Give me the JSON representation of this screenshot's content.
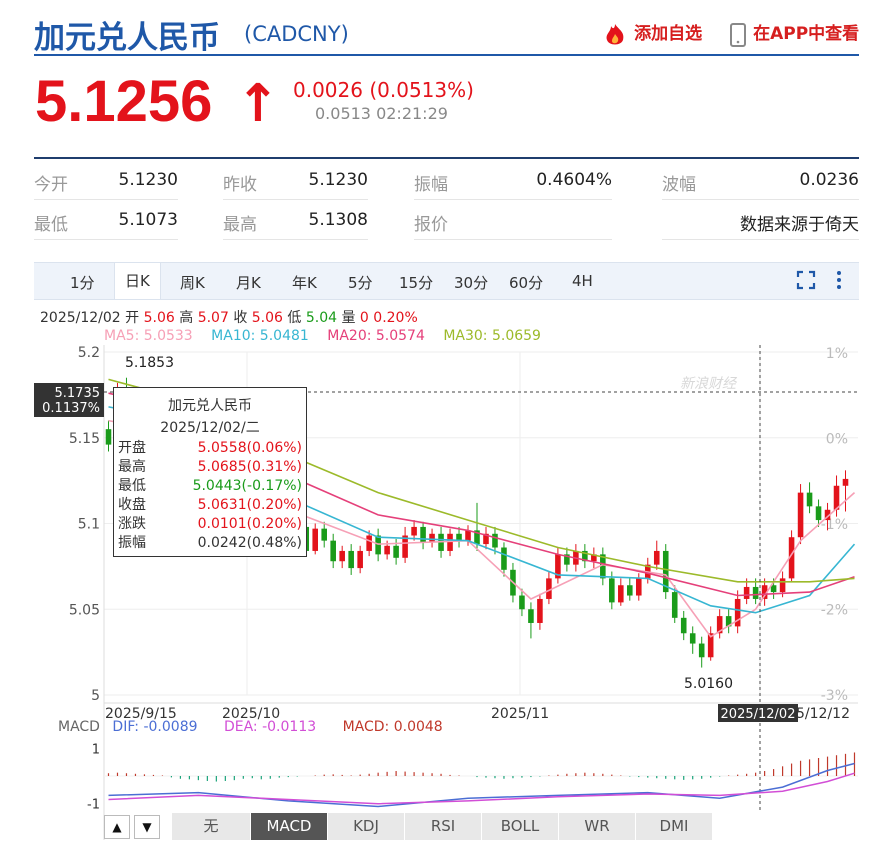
{
  "header": {
    "title": "加元兑人民币",
    "code": "(CADCNY)",
    "add_watch_label": "添加自选",
    "app_view_label": "在APP中查看"
  },
  "quote": {
    "price": "5.1256",
    "arrow": "↑",
    "change": "0.0026 (0.0513%)",
    "sub": "0.0513 02:21:29"
  },
  "stats": [
    {
      "label": "今开",
      "value": "5.1230"
    },
    {
      "label": "昨收",
      "value": "5.1230"
    },
    {
      "label": "振幅",
      "value": "0.4604%"
    },
    {
      "label": "波幅",
      "value": "0.0236"
    },
    {
      "label": "最低",
      "value": "5.1073"
    },
    {
      "label": "最高",
      "value": "5.1308"
    },
    {
      "label": "报价",
      "value": ""
    },
    {
      "label": "",
      "value": "数据来源于倚天"
    }
  ],
  "tabs": [
    "1分",
    "日K",
    "周K",
    "月K",
    "年K",
    "5分",
    "15分",
    "30分",
    "60分",
    "4H"
  ],
  "active_tab": "日K",
  "info": {
    "date": "2025/12/02",
    "open_label": "开",
    "open": "5.06",
    "high_label": "高",
    "high": "5.07",
    "close_label": "收",
    "close": "5.06",
    "low_label": "低",
    "low": "5.04",
    "vol_label": "量",
    "vol": "0",
    "pct": "0.20%"
  },
  "ma": [
    {
      "label": "MA5: 5.0533",
      "color": "#f6a0b6"
    },
    {
      "label": "MA10: 5.0481",
      "color": "#37b6d2"
    },
    {
      "label": "MA20: 5.0574",
      "color": "#e5407a"
    },
    {
      "label": "MA30: 5.0659",
      "color": "#9cba2a"
    }
  ],
  "tooltip": {
    "title": "加元兑人民币",
    "date": "2025/12/02/二",
    "rows": [
      {
        "label": "开盘",
        "value": "5.0558(0.06%)",
        "color": "#e3131b"
      },
      {
        "label": "最高",
        "value": "5.0685(0.31%)",
        "color": "#e3131b"
      },
      {
        "label": "最低",
        "value": "5.0443(-0.17%)",
        "color": "#1a9b1a"
      },
      {
        "label": "收盘",
        "value": "5.0631(0.20%)",
        "color": "#e3131b"
      },
      {
        "label": "涨跌",
        "value": "0.0101(0.20%)",
        "color": "#e3131b"
      },
      {
        "label": "振幅",
        "value": "0.0242(0.48%)",
        "color": "#333333"
      }
    ]
  },
  "crosshair": {
    "price": "5.1735",
    "pct": "0.1137%",
    "date": "2025/12/02"
  },
  "watermark": "新浪财经",
  "macd_line": {
    "label": "MACD",
    "dif": "DIF: -0.0089",
    "dea": "DEA: -0.0113",
    "macd": "MACD: 0.0048",
    "dif_color": "#4b6ed4",
    "dea_color": "#d24ed6",
    "macd_color": "#c0392b"
  },
  "indicator_buttons": [
    "无",
    "MACD",
    "KDJ",
    "RSI",
    "BOLL",
    "WR",
    "DMI"
  ],
  "active_indicator": "MACD",
  "nav_up": "▲",
  "nav_down": "▼",
  "chart_data": {
    "type": "candlestick",
    "ylim": [
      5.0,
      5.2
    ],
    "y_ticks": [
      "5.2",
      "5.15",
      "5.1",
      "5.05",
      "5"
    ],
    "pct_ticks": [
      "1%",
      "0%",
      "-1%",
      "-2%",
      "-3%"
    ],
    "x_labels": [
      "2025/9/15",
      "2025/10",
      "2025/11",
      "5/12/12"
    ],
    "annotations": {
      "high": "5.1853",
      "low": "5.0160"
    },
    "candles": [
      [
        5.155,
        5.146,
        5.16,
        5.142
      ],
      [
        5.145,
        5.178,
        5.182,
        5.143
      ],
      [
        5.178,
        5.172,
        5.185,
        5.169
      ],
      [
        5.172,
        5.16,
        5.176,
        5.156
      ],
      [
        5.16,
        5.15,
        5.164,
        5.146
      ],
      [
        5.15,
        5.163,
        5.166,
        5.147
      ],
      [
        5.163,
        5.172,
        5.176,
        5.16
      ],
      [
        5.172,
        5.16,
        5.175,
        5.156
      ],
      [
        5.16,
        5.152,
        5.164,
        5.149
      ],
      [
        5.152,
        5.156,
        5.159,
        5.148
      ],
      [
        5.156,
        5.146,
        5.16,
        5.142
      ],
      [
        5.146,
        5.135,
        5.15,
        5.132
      ],
      [
        5.135,
        5.143,
        5.146,
        5.132
      ],
      [
        5.143,
        5.14,
        5.146,
        5.136
      ],
      [
        5.14,
        5.13,
        5.144,
        5.127
      ],
      [
        5.13,
        5.128,
        5.134,
        5.124
      ],
      [
        5.128,
        5.12,
        5.132,
        5.116
      ],
      [
        5.12,
        5.117,
        5.124,
        5.113
      ],
      [
        5.117,
        5.114,
        5.12,
        5.11
      ],
      [
        5.114,
        5.104,
        5.118,
        5.101
      ],
      [
        5.104,
        5.09,
        5.108,
        5.086
      ],
      [
        5.09,
        5.098,
        5.101,
        5.084
      ],
      [
        5.098,
        5.084,
        5.101,
        5.081
      ],
      [
        5.084,
        5.097,
        5.1,
        5.082
      ],
      [
        5.097,
        5.09,
        5.101,
        5.086
      ],
      [
        5.09,
        5.078,
        5.094,
        5.074
      ],
      [
        5.078,
        5.084,
        5.087,
        5.074
      ],
      [
        5.084,
        5.074,
        5.088,
        5.07
      ],
      [
        5.074,
        5.084,
        5.087,
        5.071
      ],
      [
        5.084,
        5.093,
        5.096,
        5.081
      ],
      [
        5.093,
        5.082,
        5.097,
        5.078
      ],
      [
        5.082,
        5.087,
        5.09,
        5.079
      ],
      [
        5.087,
        5.08,
        5.091,
        5.076
      ],
      [
        5.08,
        5.093,
        5.098,
        5.077
      ],
      [
        5.093,
        5.098,
        5.102,
        5.09
      ],
      [
        5.098,
        5.089,
        5.101,
        5.085
      ],
      [
        5.089,
        5.094,
        5.097,
        5.086
      ],
      [
        5.094,
        5.084,
        5.098,
        5.08
      ],
      [
        5.084,
        5.094,
        5.097,
        5.081
      ],
      [
        5.094,
        5.09,
        5.098,
        5.086
      ],
      [
        5.09,
        5.096,
        5.099,
        5.087
      ],
      [
        5.096,
        5.088,
        5.112,
        5.084
      ],
      [
        5.088,
        5.094,
        5.098,
        5.085
      ],
      [
        5.094,
        5.086,
        5.098,
        5.082
      ],
      [
        5.086,
        5.073,
        5.089,
        5.069
      ],
      [
        5.073,
        5.058,
        5.077,
        5.054
      ],
      [
        5.058,
        5.05,
        5.062,
        5.046
      ],
      [
        5.05,
        5.042,
        5.054,
        5.033
      ],
      [
        5.042,
        5.056,
        5.059,
        5.038
      ],
      [
        5.056,
        5.068,
        5.072,
        5.053
      ],
      [
        5.068,
        5.082,
        5.086,
        5.065
      ],
      [
        5.082,
        5.076,
        5.086,
        5.072
      ],
      [
        5.076,
        5.084,
        5.088,
        5.072
      ],
      [
        5.084,
        5.078,
        5.088,
        5.074
      ],
      [
        5.078,
        5.082,
        5.086,
        5.074
      ],
      [
        5.082,
        5.068,
        5.086,
        5.064
      ],
      [
        5.068,
        5.054,
        5.072,
        5.05
      ],
      [
        5.054,
        5.064,
        5.068,
        5.052
      ],
      [
        5.064,
        5.058,
        5.068,
        5.055
      ],
      [
        5.058,
        5.068,
        5.071,
        5.055
      ],
      [
        5.068,
        5.076,
        5.08,
        5.065
      ],
      [
        5.076,
        5.084,
        5.09,
        5.073
      ],
      [
        5.084,
        5.06,
        5.088,
        5.056
      ],
      [
        5.06,
        5.045,
        5.064,
        5.042
      ],
      [
        5.045,
        5.036,
        5.049,
        5.032
      ],
      [
        5.036,
        5.03,
        5.04,
        5.024
      ],
      [
        5.03,
        5.022,
        5.034,
        5.016
      ],
      [
        5.022,
        5.036,
        5.04,
        5.02
      ],
      [
        5.036,
        5.046,
        5.05,
        5.033
      ],
      [
        5.046,
        5.04,
        5.05,
        5.036
      ],
      [
        5.04,
        5.056,
        5.061,
        5.036
      ],
      [
        5.056,
        5.063,
        5.068,
        5.053
      ],
      [
        5.063,
        5.056,
        5.068,
        5.053
      ],
      [
        5.056,
        5.064,
        5.068,
        5.052
      ],
      [
        5.064,
        5.06,
        5.068,
        5.056
      ],
      [
        5.06,
        5.068,
        5.072,
        5.057
      ],
      [
        5.068,
        5.092,
        5.096,
        5.066
      ],
      [
        5.092,
        5.118,
        5.123,
        5.088
      ],
      [
        5.118,
        5.11,
        5.124,
        5.106
      ],
      [
        5.11,
        5.102,
        5.114,
        5.098
      ],
      [
        5.102,
        5.108,
        5.112,
        5.096
      ],
      [
        5.108,
        5.122,
        5.128,
        5.104
      ],
      [
        5.122,
        5.126,
        5.131,
        5.107
      ]
    ],
    "ma_series": [
      {
        "name": "MA5",
        "color": "#f6a0b6",
        "values": [
          [
            0,
            5.16
          ],
          [
            10,
            5.15
          ],
          [
            20,
            5.108
          ],
          [
            30,
            5.088
          ],
          [
            40,
            5.09
          ],
          [
            47,
            5.056
          ],
          [
            55,
            5.076
          ],
          [
            62,
            5.07
          ],
          [
            67,
            5.034
          ],
          [
            72,
            5.05
          ],
          [
            77,
            5.09
          ],
          [
            83,
            5.118
          ]
        ]
      },
      {
        "name": "MA10",
        "color": "#37b6d2",
        "values": [
          [
            0,
            5.168
          ],
          [
            10,
            5.158
          ],
          [
            20,
            5.115
          ],
          [
            30,
            5.092
          ],
          [
            40,
            5.09
          ],
          [
            50,
            5.07
          ],
          [
            60,
            5.068
          ],
          [
            67,
            5.052
          ],
          [
            72,
            5.048
          ],
          [
            78,
            5.058
          ],
          [
            83,
            5.088
          ]
        ]
      },
      {
        "name": "MA20",
        "color": "#e5407a",
        "values": [
          [
            0,
            5.176
          ],
          [
            10,
            5.164
          ],
          [
            20,
            5.128
          ],
          [
            30,
            5.105
          ],
          [
            40,
            5.096
          ],
          [
            50,
            5.082
          ],
          [
            60,
            5.071
          ],
          [
            70,
            5.058
          ],
          [
            78,
            5.06
          ],
          [
            83,
            5.069
          ]
        ]
      },
      {
        "name": "MA30",
        "color": "#9cba2a",
        "values": [
          [
            0,
            5.184
          ],
          [
            10,
            5.17
          ],
          [
            20,
            5.14
          ],
          [
            30,
            5.118
          ],
          [
            40,
            5.102
          ],
          [
            50,
            5.086
          ],
          [
            60,
            5.075
          ],
          [
            70,
            5.066
          ],
          [
            78,
            5.066
          ],
          [
            83,
            5.068
          ]
        ]
      }
    ],
    "macd": {
      "ylim": [
        -1.3,
        1.3
      ],
      "ticks": [
        "1",
        "-1"
      ],
      "dif": [
        [
          0,
          -0.7
        ],
        [
          10,
          -0.6
        ],
        [
          20,
          -0.9
        ],
        [
          30,
          -1.1
        ],
        [
          40,
          -0.8
        ],
        [
          50,
          -0.7
        ],
        [
          60,
          -0.6
        ],
        [
          68,
          -0.8
        ],
        [
          75,
          -0.4
        ],
        [
          80,
          0.2
        ],
        [
          83,
          0.45
        ]
      ],
      "dea": [
        [
          0,
          -0.85
        ],
        [
          10,
          -0.7
        ],
        [
          20,
          -0.85
        ],
        [
          30,
          -1.0
        ],
        [
          40,
          -0.9
        ],
        [
          50,
          -0.75
        ],
        [
          60,
          -0.65
        ],
        [
          68,
          -0.7
        ],
        [
          75,
          -0.55
        ],
        [
          80,
          -0.2
        ],
        [
          83,
          0.1
        ]
      ],
      "hist": [
        0.1,
        0.12,
        0.1,
        0.08,
        0.06,
        0.04,
        0.02,
        -0.05,
        -0.1,
        -0.12,
        -0.15,
        -0.18,
        -0.2,
        -0.18,
        -0.15,
        -0.1,
        -0.08,
        -0.12,
        -0.1,
        -0.06,
        -0.04,
        -0.02,
        0.0,
        0.02,
        0.05,
        0.06,
        0.04,
        0.02,
        0.05,
        0.08,
        0.12,
        0.15,
        0.18,
        0.16,
        0.14,
        0.12,
        0.1,
        0.08,
        0.04,
        0.02,
        0.0,
        -0.04,
        -0.06,
        -0.08,
        -0.1,
        -0.08,
        -0.06,
        -0.04,
        -0.02,
        0.02,
        0.05,
        0.08,
        0.1,
        0.12,
        0.1,
        0.08,
        0.05,
        0.02,
        -0.02,
        -0.04,
        -0.06,
        -0.08,
        -0.1,
        -0.12,
        -0.14,
        -0.12,
        -0.1,
        -0.06,
        -0.02,
        0.02,
        0.05,
        0.08,
        0.12,
        0.18,
        0.25,
        0.35,
        0.45,
        0.55,
        0.6,
        0.65,
        0.7,
        0.75,
        0.8,
        0.85
      ]
    }
  }
}
